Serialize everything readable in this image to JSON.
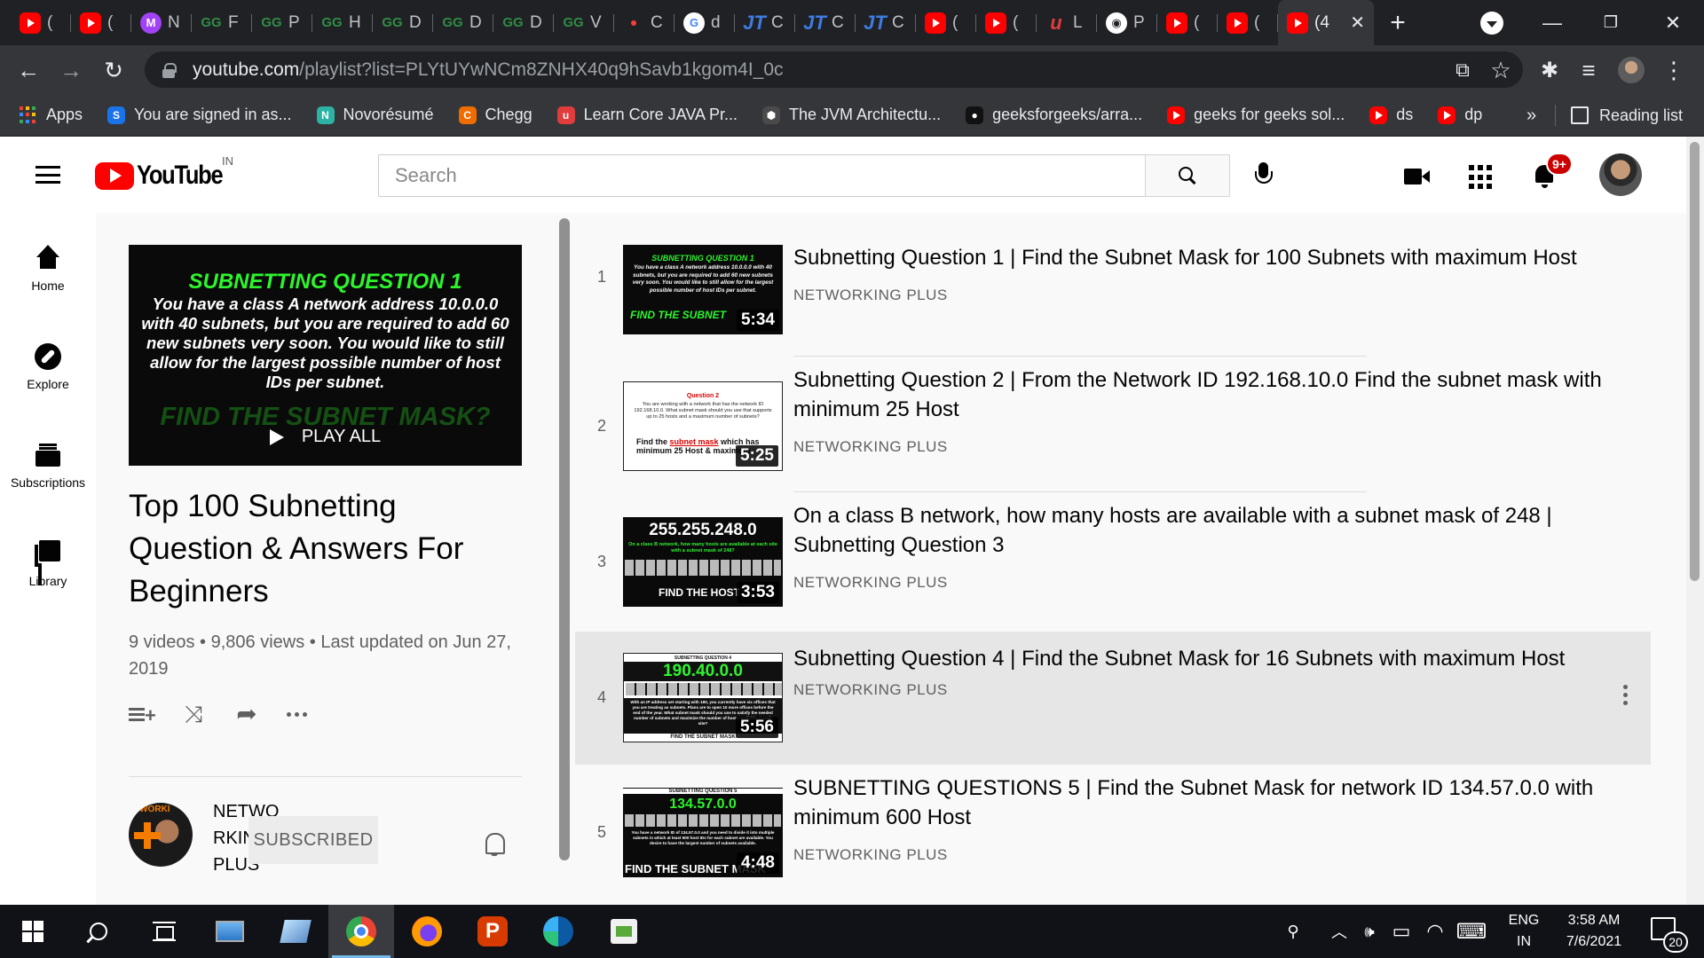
{
  "browser": {
    "tabs": [
      {
        "icon": "youtube-icon",
        "label": "("
      },
      {
        "icon": "youtube-icon",
        "label": "("
      },
      {
        "icon": "m-avatar-icon",
        "letter": "M",
        "label": "N"
      },
      {
        "icon": "geeksforgeeks-icon",
        "letter": "GG",
        "label": "F"
      },
      {
        "icon": "geeksforgeeks-icon",
        "letter": "GG",
        "label": "P"
      },
      {
        "icon": "geeksforgeeks-icon",
        "letter": "GG",
        "label": "H"
      },
      {
        "icon": "geeksforgeeks-icon",
        "letter": "GG",
        "label": "D"
      },
      {
        "icon": "geeksforgeeks-icon",
        "letter": "GG",
        "label": "D"
      },
      {
        "icon": "geeksforgeeks-icon",
        "letter": "GG",
        "label": "D"
      },
      {
        "icon": "geeksforgeeks-icon",
        "letter": "GG",
        "label": "V"
      },
      {
        "icon": "red-dot-icon",
        "label": "C"
      },
      {
        "icon": "google-icon",
        "letter": "G",
        "label": "d"
      },
      {
        "icon": "javatpoint-icon",
        "letter": "JT",
        "label": "C"
      },
      {
        "icon": "javatpoint-icon",
        "letter": "JT",
        "label": "C"
      },
      {
        "icon": "javatpoint-icon",
        "letter": "JT",
        "label": "C"
      },
      {
        "icon": "youtube-icon",
        "label": "("
      },
      {
        "icon": "youtube-icon",
        "label": "("
      },
      {
        "icon": "udemy-icon",
        "letter": "u",
        "label": "L"
      },
      {
        "icon": "globe-icon",
        "letter": "◉",
        "label": "P"
      },
      {
        "icon": "youtube-icon",
        "label": "("
      },
      {
        "icon": "youtube-icon",
        "label": "("
      }
    ],
    "active_tab": {
      "label": "(4",
      "close": "✕"
    },
    "new_tab": "+",
    "window": {
      "minimize": "—",
      "restore": "❐",
      "close": "✕"
    },
    "url_host": "youtube.com",
    "url_path": "/playlist?list=PLYtUYwNCm8ZNHX40q9hSavb1kgom4I_0c",
    "nav": {
      "back": "←",
      "forward": "→",
      "reload": "↻"
    },
    "omnibox_icons": {
      "open_in_app": "⧉",
      "bookmark_star": "☆"
    },
    "toolbar_icons": {
      "extensions": "✱",
      "media": "≡",
      "menu": "⋮"
    },
    "bookmarks": [
      {
        "icon": "apps-grid-icon",
        "label": "Apps"
      },
      {
        "icon": "signed-in-icon",
        "letter": "S",
        "color": "#1a73e8",
        "label": "You are signed in as..."
      },
      {
        "icon": "novoresume-icon",
        "letter": "N",
        "color": "#2bb3a4",
        "label": "Novorésumé"
      },
      {
        "icon": "chegg-icon",
        "letter": "C",
        "color": "#ef6c00",
        "label": "Chegg"
      },
      {
        "icon": "udemy-icon",
        "letter": "u",
        "color": "#e03c3c",
        "label": "Learn Core JAVA Pr..."
      },
      {
        "icon": "jvm-icon",
        "letter": "⬢",
        "color": "#4a4a4a",
        "label": "The JVM Architectu..."
      },
      {
        "icon": "github-icon",
        "letter": "●",
        "color": "#111111",
        "label": "geeksforgeeks/arra..."
      },
      {
        "icon": "youtube-icon",
        "label": "geeks for geeks sol..."
      },
      {
        "icon": "youtube-icon",
        "label": "ds"
      },
      {
        "icon": "youtube-icon",
        "label": "dp"
      }
    ],
    "bookmarks_more": "»",
    "reading_list": "Reading list"
  },
  "youtube": {
    "logo_text": "YouTube",
    "region": "IN",
    "search_placeholder": "Search",
    "notification_count": "9+",
    "guide": [
      {
        "icon": "home-icon",
        "label": "Home"
      },
      {
        "icon": "explore-icon",
        "label": "Explore"
      },
      {
        "icon": "subscriptions-icon",
        "label": "Subscriptions"
      },
      {
        "icon": "library-icon",
        "label": "Library"
      }
    ],
    "playlist": {
      "thumb_heading": "SUBNETTING QUESTION 1",
      "thumb_body": "You have a class A network address 10.0.0.0 with 40 subnets, but you are required to add 60 new subnets very soon. You would like to still allow for the largest possible number of host IDs per subnet.",
      "thumb_footer": "FIND THE SUBNET MASK?",
      "play_all": "PLAY ALL",
      "title": "Top 100 Subnetting Question & Answers For Beginners",
      "stats": "9 videos • 9,806 views • Last updated on Jun 27, 2019",
      "shuffle_glyph": "⤨",
      "share_glyph": "➦",
      "channel_name": "NETWORKING PLUS",
      "channel_avatar_text": "TWORKI",
      "subscribe_label": "SUBSCRIBED"
    },
    "videos": [
      {
        "index": "1",
        "title": "Subnetting Question 1 | Find the Subnet Mask for 100 Subnets with maximum Host",
        "channel": "NETWORKING PLUS",
        "duration": "5:34",
        "thumb_heading": "SUBNETTING QUESTION 1",
        "thumb_body": "You have a class A network address 10.0.0.0 with 40 subnets, but you are required to add 60 new subnets very soon. You would like to still allow for the largest possible number of host IDs per subnet.",
        "thumb_footer": "FIND THE SUBNET"
      },
      {
        "index": "2",
        "title": "Subnetting Question 2 | From the Network ID 192.168.10.0 Find the subnet mask with minimum 25 Host",
        "channel": "NETWORKING PLUS",
        "duration": "5:25",
        "thumb_heading": "Question 2",
        "thumb_body": "You are working with a network that has the network ID 192.168.10.0. What subnet mask should you use that supports up to 25 hosts and a maximum number of subnets?",
        "thumb_footer_a": "Find the ",
        "thumb_footer_b": "subnet mask",
        "thumb_footer_c": " which has minimum 25 Host & maximum"
      },
      {
        "index": "3",
        "title": "On a class B network, how many hosts are available with a subnet mask of 248 | Subnetting Question 3",
        "channel": "NETWORKING PLUS",
        "duration": "3:53",
        "thumb_heading": "255.255.248.0",
        "thumb_body": "On a class B network, how many hosts are available at each site with a subnet mask of 248?",
        "thumb_footer": "FIND THE HOST"
      },
      {
        "index": "4",
        "title": "Subnetting Question 4 | Find the Subnet Mask for 16 Subnets with maximum Host",
        "channel": "NETWORKING PLUS",
        "duration": "5:56",
        "thumb_small": "SUBNETTING QUESTION 4",
        "thumb_heading": "190.40.0.0",
        "thumb_body": "With an IP address set starting with 190, you currently have six offices that you are treating as subnets. Plans are to open 10 more offices before the end of the year. What subnet mask should you use to satisfy the needed number of subnets and maximize the number of hosts available at each site?",
        "thumb_footer": "FIND THE SUBNET MASK"
      },
      {
        "index": "5",
        "title": "SUBNETTING QUESTIONS 5 | Find the Subnet Mask for network ID 134.57.0.0 with minimum 600 Host",
        "channel": "NETWORKING PLUS",
        "duration": "4:48",
        "thumb_small": "SUBNETTING QUESTION 5",
        "thumb_heading": "134.57.0.0",
        "thumb_body": "You have a network ID of 134.57.0.0 and you need to divide it into multiple subnets in which at least 600 host IDs for each subnet are available. You desire to have the largest number of subnets available.",
        "thumb_footer": "FIND THE SUBNET MASK"
      }
    ]
  },
  "taskbar": {
    "apps": [
      "start",
      "search",
      "task-view",
      "this-pc",
      "cmd",
      "chrome",
      "firefox",
      "wps",
      "edge",
      "vs"
    ],
    "tray_glyphs": {
      "people": "⚲",
      "chevron": "︿",
      "volume": "🕪",
      "battery": "▭",
      "wifi": "◠",
      "keyboard": "⌨"
    },
    "lang_top": "ENG",
    "lang_bottom": "IN",
    "time": "3:58 AM",
    "date": "7/6/2021",
    "notification_count": "20"
  }
}
